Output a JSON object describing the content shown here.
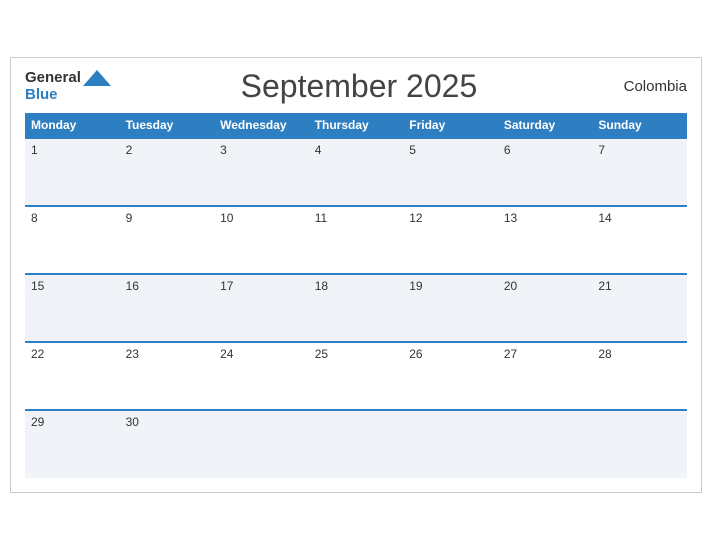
{
  "header": {
    "logo_general": "General",
    "logo_blue": "Blue",
    "title": "September 2025",
    "country": "Colombia"
  },
  "days_of_week": [
    "Monday",
    "Tuesday",
    "Wednesday",
    "Thursday",
    "Friday",
    "Saturday",
    "Sunday"
  ],
  "weeks": [
    [
      1,
      2,
      3,
      4,
      5,
      6,
      7
    ],
    [
      8,
      9,
      10,
      11,
      12,
      13,
      14
    ],
    [
      15,
      16,
      17,
      18,
      19,
      20,
      21
    ],
    [
      22,
      23,
      24,
      25,
      26,
      27,
      28
    ],
    [
      29,
      30,
      null,
      null,
      null,
      null,
      null
    ]
  ]
}
